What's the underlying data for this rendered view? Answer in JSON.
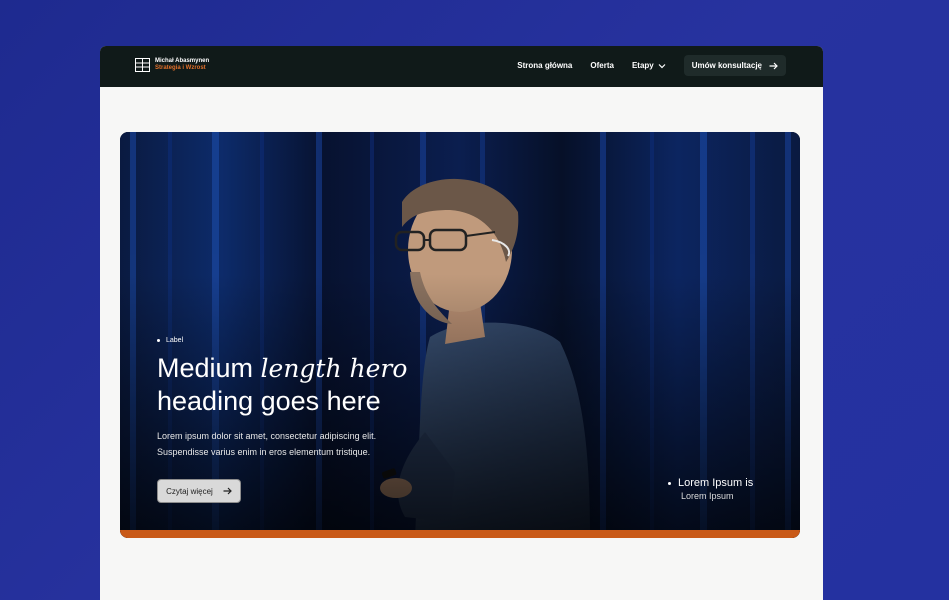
{
  "brand": {
    "name": "Michał Abasmynen",
    "tagline": "Strategia i Wzrost"
  },
  "nav": {
    "links": [
      "Strona główna",
      "Oferta"
    ],
    "dropdown_label": "Etapy",
    "cta_label": "Umów konsultację"
  },
  "hero": {
    "tagline": "Label",
    "heading_line1_plain": "Medium ",
    "heading_line1_italic": "length hero",
    "heading_line2": "heading goes here",
    "body_line1": "Lorem ipsum dolor sit amet, consectetur adipiscing elit.",
    "body_line2": "Suspendisse varius enim in eros elementum tristique.",
    "button_label": "Czytaj więcej",
    "callout_title": "Lorem Ipsum is",
    "callout_subtitle": "Lorem Ipsum"
  },
  "colors": {
    "background": "#2431a0",
    "navbar": "#101a19",
    "accent_orange": "#c95a18",
    "brand_tag": "#e2702a",
    "page": "#f7f7f6"
  },
  "icons": [
    "brand-logo-icon",
    "chevron-down-icon",
    "arrow-right-icon"
  ]
}
